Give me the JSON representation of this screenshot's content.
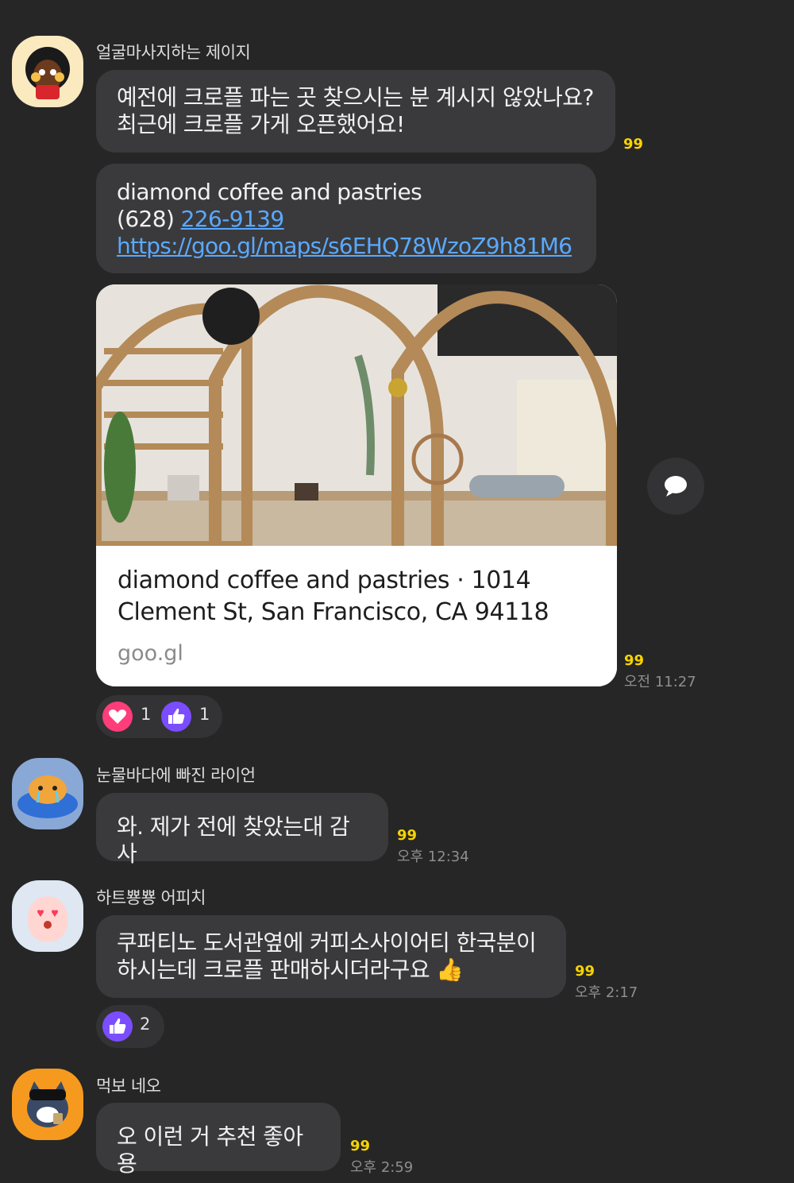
{
  "messages": [
    {
      "sender": "얼굴마사지하는 제이지",
      "avatar_icon": "jay-g-emoticon-icon",
      "text_lines": [
        "예전에 크로플 파는 곳 찾으시는 분 계시지 않았나요?",
        "최근에 크로플 가게 오픈했어요!"
      ],
      "unread": "99"
    },
    {
      "name_line": "diamond coffee and pastries",
      "phone_prefix": "(628) ",
      "phone_link": "226-9139",
      "url": "https://goo.gl/maps/s6EHQ78WzoZ9h81M6"
    },
    {
      "card_title": "diamond coffee and pastries · 1014 Clement St, San Francisco, CA 94118",
      "card_domain": "goo.gl",
      "card_image_icon": "cafe-interior-photo",
      "unread": "99",
      "time": "오전 11:27",
      "reactions": [
        {
          "icon": "heart-icon",
          "color": "#ff3d7a",
          "count": "1"
        },
        {
          "icon": "thumbs-up-icon",
          "color": "#7b4dff",
          "count": "1"
        }
      ]
    },
    {
      "sender": "눈물바다에 빠진 라이언",
      "avatar_icon": "ryan-crying-emoticon-icon",
      "text": "와. 제가 전에 찾았는대 감사",
      "unread": "99",
      "time": "오후 12:34"
    },
    {
      "sender": "하트뿅뿅 어피치",
      "avatar_icon": "apeach-heart-eyes-emoticon-icon",
      "text_lines": [
        "쿠퍼티노 도서관옆에 커피소사이어티 한국분이",
        "하시는데 크로플 판매하시더라구요 👍"
      ],
      "unread": "99",
      "time": "오후 2:17",
      "reactions": [
        {
          "icon": "thumbs-up-icon",
          "color": "#7b4dff",
          "count": "2"
        }
      ]
    },
    {
      "sender": "먹보 네오",
      "avatar_icon": "neo-eating-emoticon-icon",
      "text": "오 이런 거 추천 좋아용",
      "unread": "99",
      "time": "오후 2:59"
    }
  ],
  "share_icon": "chat-bubble-icon"
}
